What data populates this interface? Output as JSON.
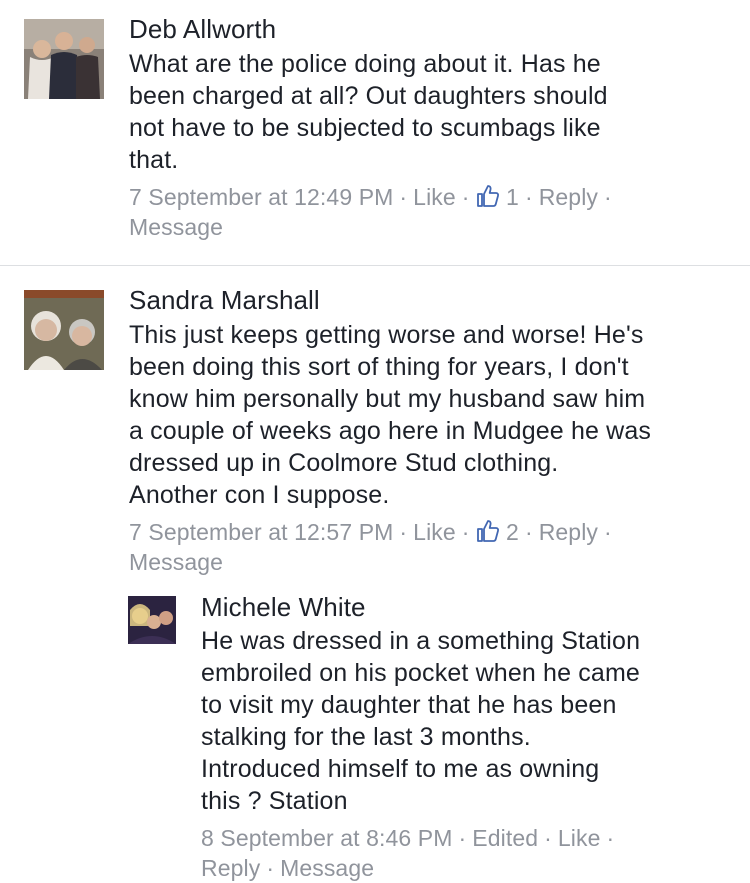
{
  "comments": [
    {
      "author": "Deb Allworth",
      "lines": [
        "What are the police doing about it. Has he",
        "been charged at all? Out daughters should",
        "not have to be subjected to scumbags like",
        "that."
      ],
      "timestamp": "7 September at 12:49 PM",
      "like_label": "Like",
      "like_count": "1",
      "reply_label": "Reply",
      "message_label": "Message"
    },
    {
      "author": "Sandra Marshall",
      "lines": [
        "This just keeps getting worse and worse! He's",
        "been doing this sort of thing for years, I don't",
        "know him personally but my husband saw him",
        "a couple of weeks ago here in Mudgee he was",
        "dressed up in Coolmore Stud clothing.",
        "Another con I suppose."
      ],
      "timestamp": "7 September at 12:57 PM",
      "like_label": "Like",
      "like_count": "2",
      "reply_label": "Reply",
      "message_label": "Message"
    }
  ],
  "reply": {
    "author": "Michele White",
    "lines": [
      "He was dressed in a something Station",
      "embroiled on his pocket when he came",
      "to visit my daughter that he has been",
      "stalking for the last 3 months.",
      "Introduced himself to me as owning",
      "this ? Station"
    ],
    "timestamp": "8 September at 8:46 PM",
    "edited_label": "Edited",
    "like_label": "Like",
    "reply_label": "Reply",
    "message_label": "Message"
  },
  "colors": {
    "text": "#1d2129",
    "meta": "#90949c",
    "like_icon": "#4267b2"
  },
  "icons": {
    "like": "thumbs-up-icon"
  }
}
